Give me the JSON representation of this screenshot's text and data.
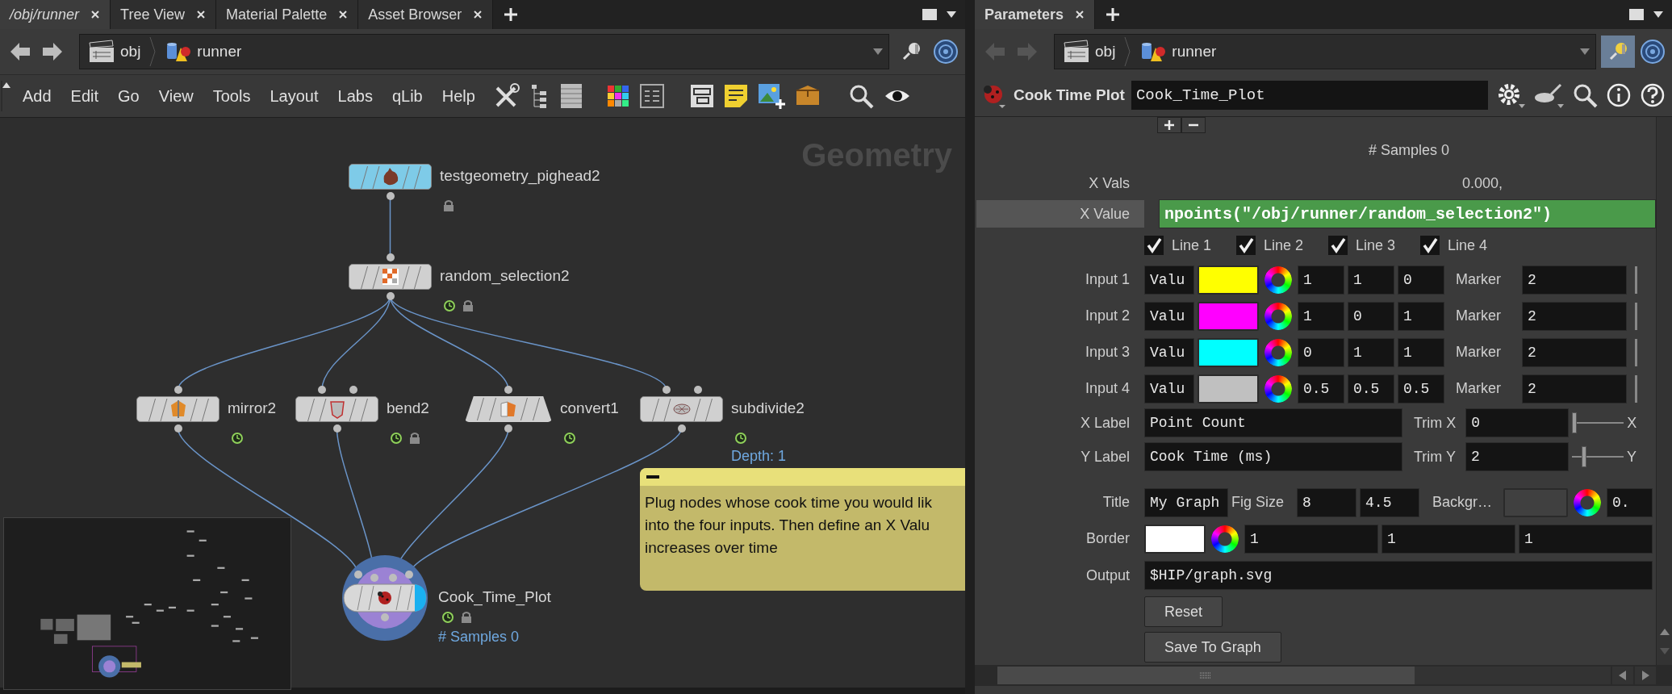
{
  "network_pane": {
    "tabs": [
      {
        "label": "/obj/runner",
        "selected": true
      },
      {
        "label": "Tree View",
        "selected": false
      },
      {
        "label": "Material Palette",
        "selected": false
      },
      {
        "label": "Asset Browser",
        "selected": false
      }
    ],
    "nav_disabled": false,
    "pinned": false,
    "path": [
      "obj",
      "runner"
    ],
    "menu": [
      "Add",
      "Edit",
      "Go",
      "View",
      "Tools",
      "Layout",
      "Labs",
      "qLib",
      "Help"
    ],
    "context_label": "Geometry",
    "nodes": [
      {
        "name": "testgeometry_pighead2",
        "kind": "box",
        "color": "#7ecbe8",
        "time_dependent": false,
        "locked": true
      },
      {
        "name": "random_selection2",
        "kind": "box",
        "color": "#d0d0d0",
        "time_dependent": true,
        "locked": true
      },
      {
        "name": "mirror2",
        "kind": "box",
        "color": "#d0d0d0",
        "time_dependent": true,
        "locked": false
      },
      {
        "name": "bend2",
        "kind": "box",
        "color": "#d0d0d0",
        "time_dependent": true,
        "locked": true
      },
      {
        "name": "convert1",
        "kind": "trapezoid",
        "color": "#d0d0d0",
        "time_dependent": true,
        "locked": false
      },
      {
        "name": "subdivide2",
        "kind": "box",
        "color": "#d0d0d0",
        "time_dependent": true,
        "locked": false,
        "info": "Depth: 1"
      },
      {
        "name": "Cook_Time_Plot",
        "kind": "circle",
        "color": "#4a6fa8",
        "time_dependent": true,
        "locked": true,
        "info": "# Samples 0"
      }
    ],
    "sticky_note": {
      "lines": [
        "Plug nodes whose cook time you would lik",
        "into the four inputs. Then define an X Valu",
        "increases over time"
      ]
    }
  },
  "parameters_pane": {
    "tabs": [
      {
        "label": "Parameters",
        "selected": true
      }
    ],
    "nav_disabled": true,
    "pinned": true,
    "path": [
      "obj",
      "runner"
    ],
    "node_type": "Cook Time Plot",
    "node_name": "Cook_Time_Plot",
    "samples_label": "# Samples 0",
    "x_vals": {
      "label": "X Vals",
      "value": "0.000,"
    },
    "x_value": {
      "label": "X Value",
      "value": "npoints(\"/obj/runner/random_selection2\")"
    },
    "lines": [
      {
        "label": "Line 1",
        "checked": true
      },
      {
        "label": "Line 2",
        "checked": true
      },
      {
        "label": "Line 3",
        "checked": true
      },
      {
        "label": "Line 4",
        "checked": true
      }
    ],
    "inputs": [
      {
        "label": "Input 1",
        "mode": "Valu",
        "color": "#ffff00",
        "rgb": [
          "1",
          "1",
          "0"
        ],
        "marker_label": "Marker",
        "marker": "2"
      },
      {
        "label": "Input 2",
        "mode": "Valu",
        "color": "#ff00ff",
        "rgb": [
          "1",
          "0",
          "1"
        ],
        "marker_label": "Marker",
        "marker": "2"
      },
      {
        "label": "Input 3",
        "mode": "Valu",
        "color": "#00ffff",
        "rgb": [
          "0",
          "1",
          "1"
        ],
        "marker_label": "Marker",
        "marker": "2"
      },
      {
        "label": "Input 4",
        "mode": "Valu",
        "color": "#c0c0c0",
        "rgb": [
          "0.5",
          "0.5",
          "0.5"
        ],
        "marker_label": "Marker",
        "marker": "2"
      }
    ],
    "x_label": {
      "label": "X Label",
      "value": "Point Count",
      "trim_label": "Trim X",
      "trim": "0",
      "axis": "X",
      "level": 0
    },
    "y_label": {
      "label": "Y Label",
      "value": "Cook Time (ms)",
      "trim_label": "Trim Y",
      "trim": "2",
      "axis": "Y",
      "level": 0.2
    },
    "title": {
      "label": "Title",
      "value": "My Graph",
      "figsize_label": "Fig Size",
      "figsize": [
        "8",
        "4.5"
      ],
      "background_label": "Backgr…",
      "background_value": "0."
    },
    "border": {
      "label": "Border",
      "color": "#ffffff",
      "values": [
        "1",
        "1",
        "1"
      ]
    },
    "output": {
      "label": "Output",
      "value": "$HIP/graph.svg"
    },
    "buttons": [
      "Reset",
      "Save To Graph"
    ]
  }
}
